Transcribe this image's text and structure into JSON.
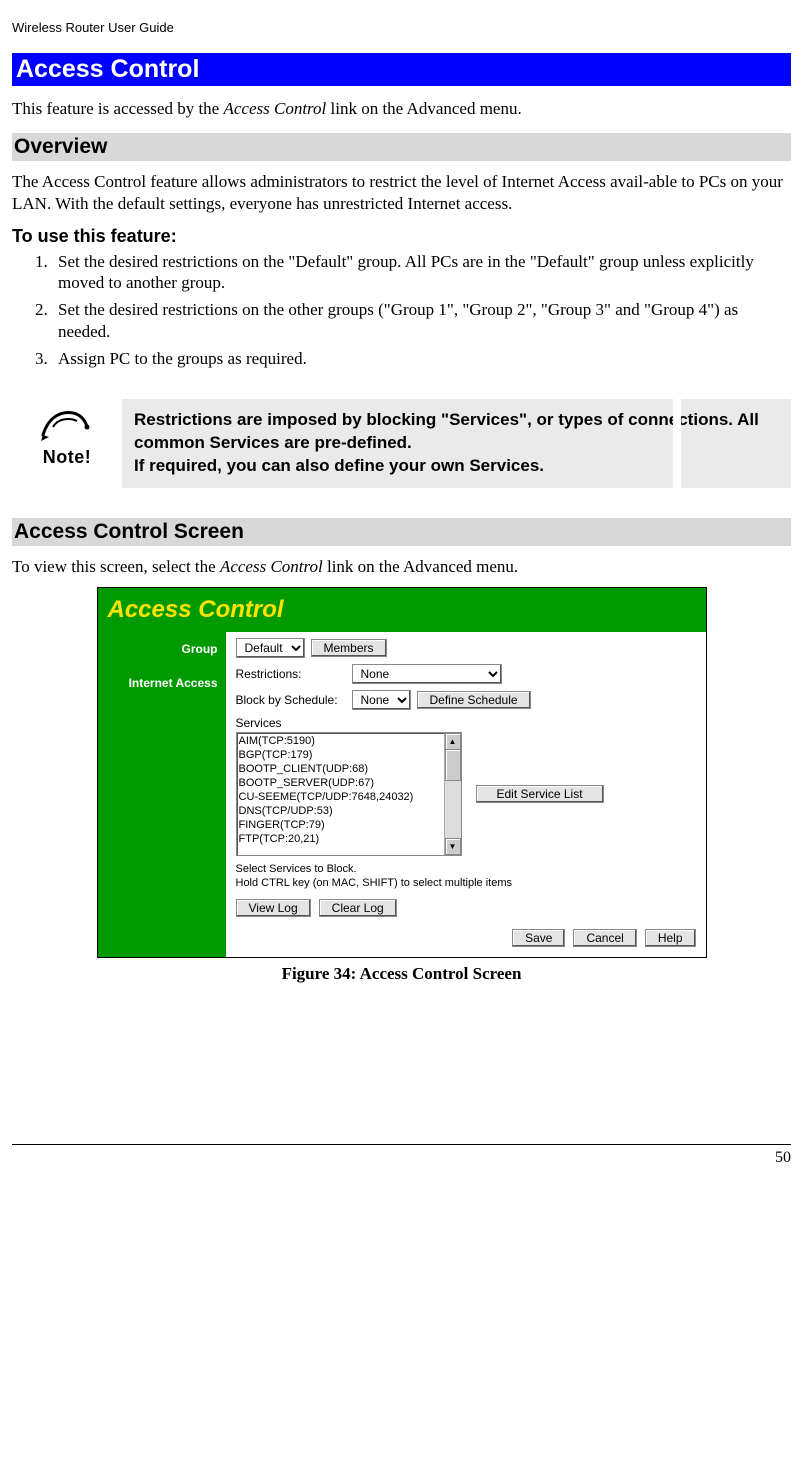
{
  "header": "Wireless Router User Guide",
  "page_title": "Access Control",
  "intro": "This feature is accessed by the Access Control link on the Advanced menu.",
  "intro_pre": "This feature is accessed by the ",
  "intro_italic": "Access Control",
  "intro_post": " link on the Advanced menu.",
  "overview_h": "Overview",
  "overview_p": "The Access Control feature allows administrators to restrict the level of Internet Access avail-able to PCs on your LAN. With the default settings, everyone has unrestricted Internet access.",
  "feature_h": "To use this feature:",
  "steps": [
    "Set the desired restrictions on the \"Default\" group. All PCs are in the \"Default\" group unless explicitly moved to another group.",
    "Set the desired restrictions on the other groups (\"Group 1\", \"Group 2\", \"Group 3\" and \"Group 4\") as needed.",
    "Assign PC to the groups as required."
  ],
  "note_label": "Note!",
  "note_line1": "Restrictions are imposed by blocking \"Services\", or types of connections. All common Services are pre-defined.",
  "note_line2": "If required, you can also define your own Services.",
  "screen_h": "Access Control Screen",
  "screen_p_pre": "To view this screen, select the ",
  "screen_p_italic": "Access Control",
  "screen_p_post": " link on the Advanced menu.",
  "caption": "Figure 34: Access Control Screen",
  "page_num": "50",
  "screenshot": {
    "title": "Access Control",
    "side": {
      "group": "Group",
      "internet": "Internet Access"
    },
    "group_select": "Default",
    "members_btn": "Members",
    "restrictions_label": "Restrictions:",
    "restrictions_value": "None",
    "block_label": "Block by Schedule:",
    "block_value": "None",
    "define_schedule_btn": "Define Schedule",
    "services_label": "Services",
    "services": [
      "AIM(TCP:5190)",
      "BGP(TCP:179)",
      "BOOTP_CLIENT(UDP:68)",
      "BOOTP_SERVER(UDP:67)",
      "CU-SEEME(TCP/UDP:7648,24032)",
      "DNS(TCP/UDP:53)",
      "FINGER(TCP:79)",
      "FTP(TCP:20,21)"
    ],
    "edit_service_btn": "Edit Service List",
    "hint1": "Select Services to Block.",
    "hint2": "Hold CTRL key (on MAC, SHIFT) to select multiple items",
    "viewlog_btn": "View Log",
    "clearlog_btn": "Clear Log",
    "save_btn": "Save",
    "cancel_btn": "Cancel",
    "help_btn": "Help"
  }
}
